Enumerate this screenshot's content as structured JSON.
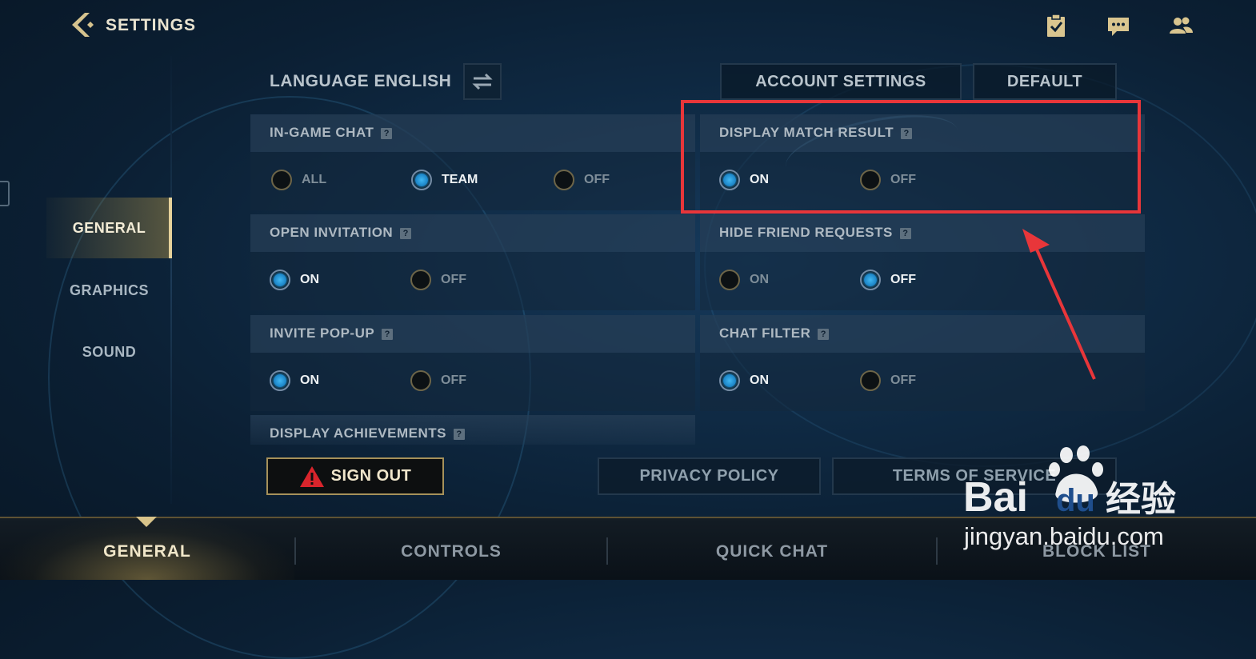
{
  "header": {
    "title": "SETTINGS"
  },
  "top_icons": [
    "clipboard-check-icon",
    "chat-bubble-icon",
    "friends-icon"
  ],
  "sidebar": {
    "items": [
      {
        "label": "GENERAL",
        "active": true
      },
      {
        "label": "GRAPHICS",
        "active": false
      },
      {
        "label": "SOUND",
        "active": false
      }
    ]
  },
  "language": {
    "label": "LANGUAGE ENGLISH"
  },
  "buttons": {
    "account_settings": "ACCOUNT SETTINGS",
    "default": "DEFAULT"
  },
  "panels": [
    {
      "title": "IN-GAME CHAT",
      "options": [
        "ALL",
        "TEAM",
        "OFF"
      ],
      "selected": "TEAM"
    },
    {
      "title": "DISPLAY MATCH RESULT",
      "options": [
        "ON",
        "OFF"
      ],
      "selected": "ON"
    },
    {
      "title": "OPEN INVITATION",
      "options": [
        "ON",
        "OFF"
      ],
      "selected": "ON"
    },
    {
      "title": "HIDE FRIEND REQUESTS",
      "options": [
        "ON",
        "OFF"
      ],
      "selected": "OFF"
    },
    {
      "title": "INVITE POP-UP",
      "options": [
        "ON",
        "OFF"
      ],
      "selected": "ON"
    },
    {
      "title": "CHAT FILTER",
      "options": [
        "ON",
        "OFF"
      ],
      "selected": "ON"
    },
    {
      "title": "DISPLAY ACHIEVEMENTS"
    }
  ],
  "help_glyph": "?",
  "footer": {
    "sign_out": "SIGN OUT",
    "privacy_policy": "PRIVACY POLICY",
    "terms_of_service": "TERMS OF SERVICE"
  },
  "tabs": [
    {
      "label": "GENERAL",
      "active": true
    },
    {
      "label": "CONTROLS",
      "active": false
    },
    {
      "label": "QUICK CHAT",
      "active": false
    },
    {
      "label": "BLOCK LIST",
      "active": false
    }
  ],
  "watermark": {
    "brand": "Bai",
    "brand_suffix": "du",
    "cn_text": "经验",
    "url": "jingyan.baidu.com"
  },
  "colors": {
    "accent_gold": "#e6d29a",
    "radio_blue": "#3fb6f2",
    "highlight_red": "#e8363a"
  }
}
